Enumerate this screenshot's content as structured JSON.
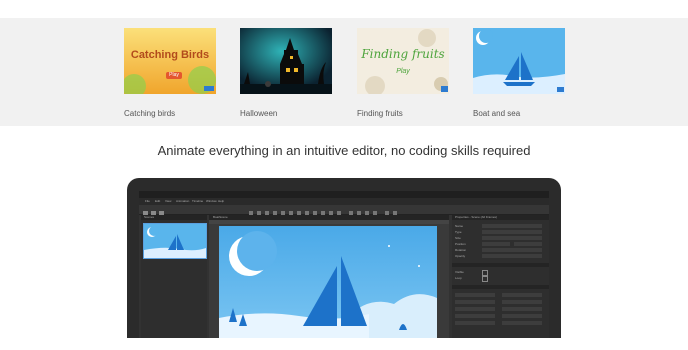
{
  "gallery": {
    "items": [
      {
        "caption": "Catching birds",
        "thumb_title": "Catching Birds",
        "thumb_button": "Play"
      },
      {
        "caption": "Halloween"
      },
      {
        "caption": "Finding fruits",
        "thumb_title": "Finding fruits",
        "thumb_button": "Play"
      },
      {
        "caption": "Boat and sea"
      }
    ]
  },
  "headline": "Animate everything in an intuitive editor, no coding skills required",
  "editor": {
    "menu": [
      "File",
      "Edit",
      "View",
      "Animation",
      "Timeline",
      "Window",
      "Help"
    ],
    "left_panel_title": "Scenes",
    "center_panel_title": "BoatScene",
    "right_panel_title": "Properties - Scene (All Frames)",
    "property_labels": [
      "Name",
      "Type",
      "Size",
      "Position",
      "Rotation",
      "Opacity",
      "Visible",
      "Loop"
    ]
  },
  "colors": {
    "gallery_bg": "#f1f1f1",
    "sky": "#59b5ec",
    "sail": "#1d72c9",
    "editor_bg": "#323232"
  }
}
